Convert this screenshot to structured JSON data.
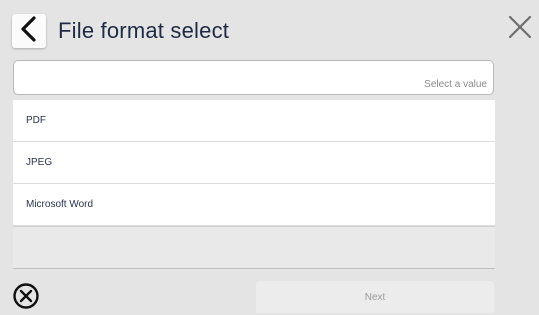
{
  "dialog": {
    "title": "File format select"
  },
  "select": {
    "placeholder": "Select a value"
  },
  "options": [
    {
      "label": "PDF"
    },
    {
      "label": "JPEG"
    },
    {
      "label": "Microsoft Word"
    }
  ],
  "footer": {
    "next_label": "Next"
  },
  "icons": {
    "back": "chevron-left-icon",
    "close": "close-icon",
    "cancel": "circle-x-icon"
  },
  "colors": {
    "background": "#e4e4e4",
    "title_text": "#1f2a44",
    "list_background": "#ffffff"
  }
}
